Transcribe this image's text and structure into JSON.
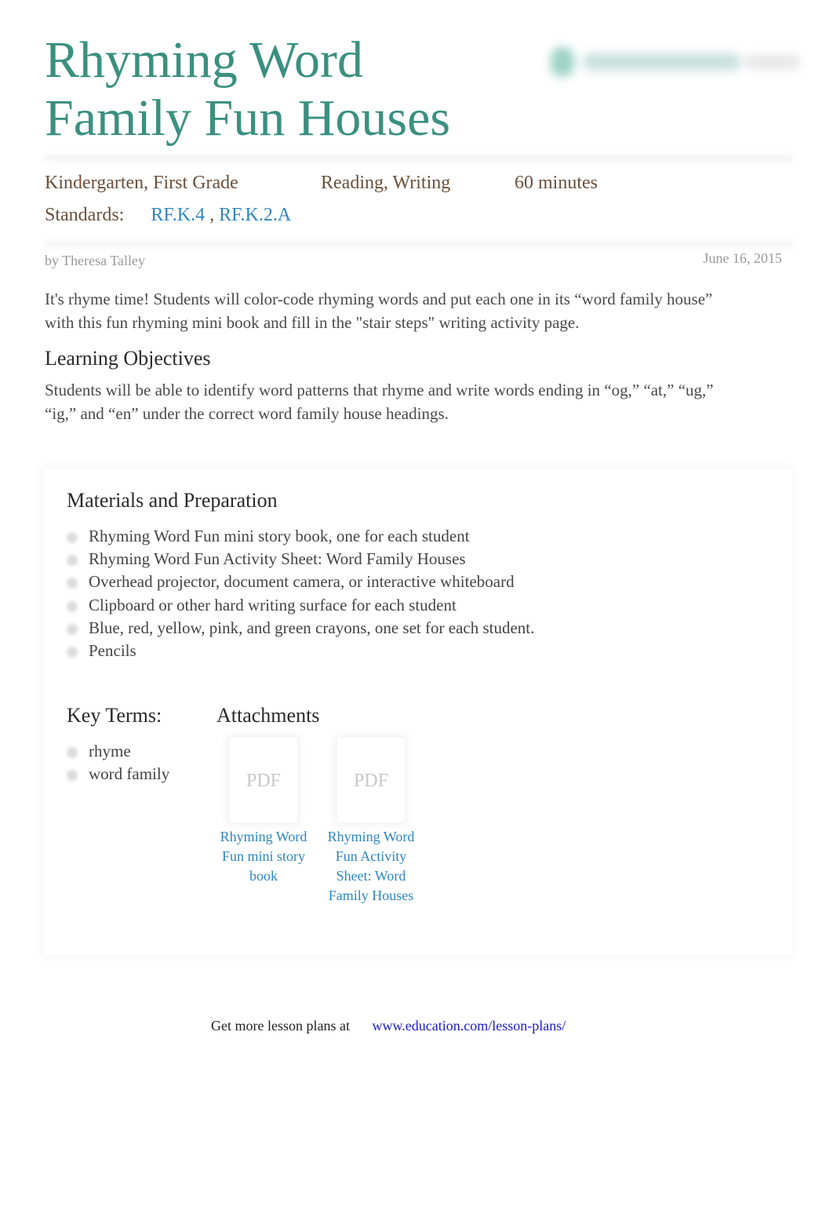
{
  "title": {
    "line1": "Rhyming Word",
    "line2": "Family Fun Houses"
  },
  "logo": {
    "icon": "education-com-logo-icon",
    "text": "education.com"
  },
  "meta": {
    "grades": "Kindergarten, First Grade",
    "subjects": "Reading, Writing",
    "duration": "60 minutes",
    "standards_label": "Standards:",
    "standards": [
      "RF.K.4",
      "RF.K.2.A"
    ],
    "standards_separator": ","
  },
  "byline": {
    "author": "by Theresa Talley",
    "date": "June 16, 2015"
  },
  "intro": "It's rhyme time! Students will color-code rhyming words and put each one in its “word family house” with this fun rhyming mini book and fill in the \"stair steps\" writing activity page.",
  "learning_objectives": {
    "heading": "Learning Objectives",
    "text": "Students will be able to identify word patterns that rhyme and write words ending in “og,” “at,” “ug,” “ig,” and “en” under the correct word family house headings."
  },
  "materials": {
    "heading": "Materials and Preparation",
    "items": [
      "Rhyming Word Fun mini story book, one for each student",
      "Rhyming Word Fun Activity Sheet: Word Family Houses",
      "Overhead projector, document camera, or interactive whiteboard",
      "Clipboard or other hard writing surface for each student",
      "Blue, red, yellow, pink, and green crayons, one set for each student.",
      "Pencils"
    ]
  },
  "key_terms": {
    "heading": "Key Terms:",
    "items": [
      "rhyme",
      "word family"
    ]
  },
  "attachments": {
    "heading": "Attachments",
    "items": [
      {
        "type": "PDF",
        "name": "Rhyming Word Fun mini story book"
      },
      {
        "type": "PDF",
        "name": "Rhyming Word Fun Activity Sheet: Word Family Houses"
      }
    ]
  },
  "footer": {
    "text": "Get more lesson plans at",
    "link": "www.education.com/lesson-plans/"
  },
  "colors": {
    "title": "#3a9080",
    "meta": "#6b4f3a",
    "link": "#2e86c1",
    "footer_link": "#1a1adb",
    "muted": "#9a9a9a"
  }
}
